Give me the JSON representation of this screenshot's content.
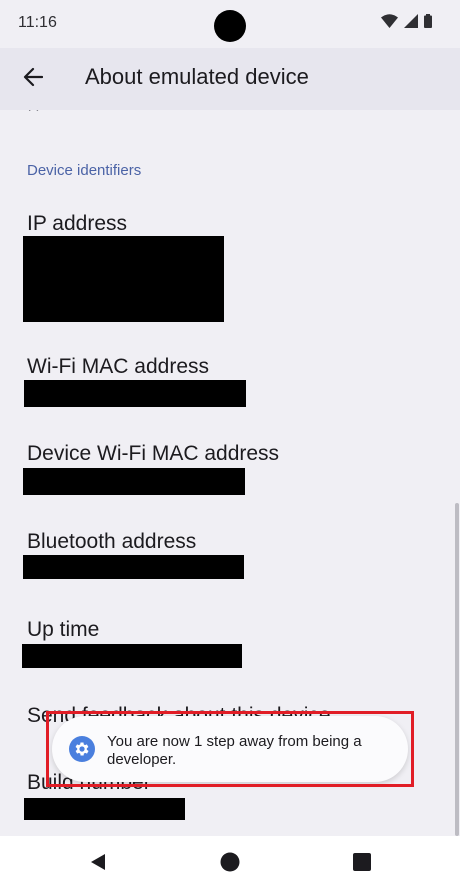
{
  "status_bar": {
    "time": "11:16"
  },
  "app_bar": {
    "title": "About emulated device"
  },
  "content": {
    "peek_text": "??",
    "section_header": "Device identifiers",
    "items": [
      {
        "title": "IP address"
      },
      {
        "title": "Wi-Fi MAC address"
      },
      {
        "title": "Device Wi-Fi MAC address"
      },
      {
        "title": "Bluetooth address"
      },
      {
        "title": "Up time"
      },
      {
        "title": "Send feedback about this device"
      },
      {
        "title": "Build number"
      }
    ]
  },
  "toast": {
    "message": "You are now 1 step away from being a developer."
  },
  "colors": {
    "accent": "#4b63a6",
    "highlight": "#e11d26",
    "toast_icon": "#4a7fde"
  },
  "icons": [
    "wifi-icon",
    "signal-icon",
    "battery-icon",
    "back-arrow-icon",
    "settings-gear-icon",
    "nav-back-icon",
    "nav-home-icon",
    "nav-recents-icon"
  ]
}
